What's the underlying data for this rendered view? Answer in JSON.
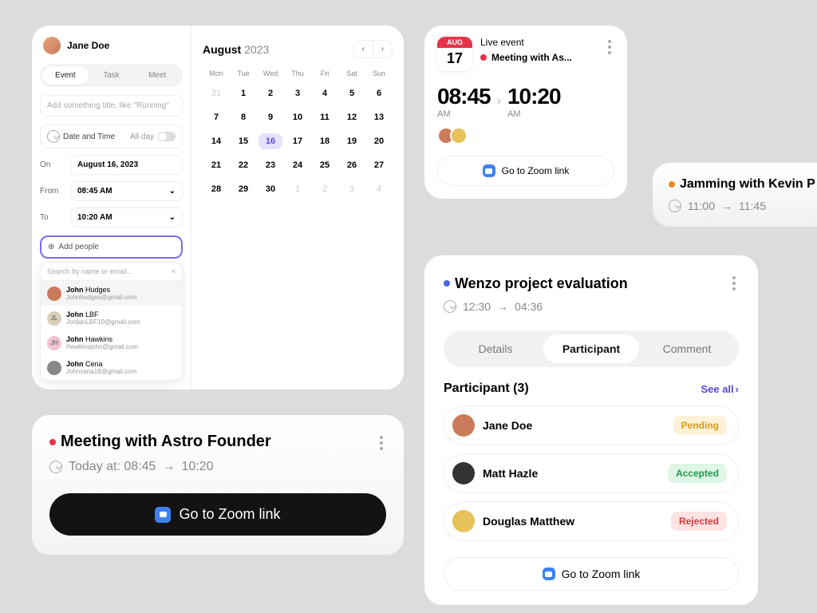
{
  "form": {
    "user": "Jane Doe",
    "tabs": [
      "Event",
      "Task",
      "Meet"
    ],
    "active_tab": 0,
    "title_placeholder": "Add something title, like \"Running\"",
    "dt_label": "Date and Time",
    "allday": "All day",
    "on_label": "On",
    "on_value": "August 16, 2023",
    "from_label": "From",
    "from_value": "08:45 AM",
    "to_label": "To",
    "to_value": "10:20 AM",
    "add_people": "Add people",
    "search_placeholder": "Search by name or email...",
    "people": [
      {
        "name_b": "John",
        "name_r": " Hudges",
        "email": "Johnhudges@gmail.com",
        "bg": "#c97b5a"
      },
      {
        "name_b": "John",
        "name_r": " LBF",
        "email": "JordanLBF10@gmail.com",
        "bg": "#d9d0b8",
        "txt": "JL"
      },
      {
        "name_b": "John",
        "name_r": " Hawkins",
        "email": "Hawkinsjohn@gmail.com",
        "bg": "#f2c2d4",
        "txt": "JH"
      },
      {
        "name_b": "John",
        "name_r": " Cena",
        "email": "Johncena19@gmail.com",
        "bg": "#888"
      }
    ]
  },
  "calendar": {
    "month": "August",
    "year": "2023",
    "dow": [
      "Mon",
      "Tue",
      "Wed",
      "Thu",
      "Fri",
      "Sat",
      "Sun"
    ],
    "lead": [
      "31"
    ],
    "days": [
      "1",
      "2",
      "3",
      "4",
      "5",
      "6",
      "7",
      "8",
      "9",
      "10",
      "11",
      "12",
      "13",
      "14",
      "15",
      "16",
      "17",
      "18",
      "19",
      "20",
      "21",
      "22",
      "23",
      "24",
      "25",
      "26",
      "27",
      "28",
      "29",
      "30"
    ],
    "trail": [
      "1",
      "2",
      "3",
      "4"
    ],
    "selected": "16"
  },
  "meeting": {
    "title": "Meeting with Astro Founder",
    "timeprefix": "Today at:",
    "from": "08:45",
    "to": "10:20",
    "zoom": "Go to Zoom link"
  },
  "live": {
    "month": "AUG",
    "day": "17",
    "head": "Live event",
    "title": "Meeting with As...",
    "from": "08:45",
    "from_ap": "AM",
    "to": "10:20",
    "to_ap": "AM",
    "zoom": "Go to Zoom link"
  },
  "jam": {
    "title": "Jamming with Kevin P",
    "from": "11:00",
    "to": "11:45"
  },
  "wenzo": {
    "title": "Wenzo project evaluation",
    "from": "12:30",
    "to": "04:36",
    "tabs": [
      "Details",
      "Participant",
      "Comment"
    ],
    "active_tab": 1,
    "participant_label": "Participant (3)",
    "see_all": "See all",
    "participants": [
      {
        "name": "Jane Doe",
        "status": "Pending",
        "cls": "pend",
        "bg": "#c97b5a"
      },
      {
        "name": "Matt Hazle",
        "status": "Accepted",
        "cls": "acc",
        "bg": "#333"
      },
      {
        "name": "Douglas Matthew",
        "status": "Rejected",
        "cls": "rej",
        "bg": "#e7c15a"
      }
    ],
    "zoom": "Go to Zoom link"
  }
}
